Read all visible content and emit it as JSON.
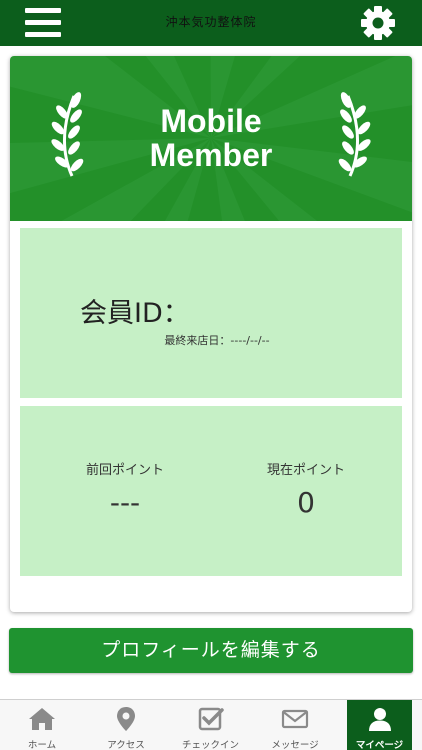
{
  "header": {
    "title": "沖本気功整体院"
  },
  "card": {
    "header_title_line1": "Mobile",
    "header_title_line2": "Member",
    "member_id_label": "会員ID：",
    "last_visit_label": "最終来店日：----/--/--",
    "previous_points_label": "前回ポイント",
    "previous_points_value": "---",
    "current_points_label": "現在ポイント",
    "current_points_value": "0"
  },
  "edit_profile_button": "プロフィールを編集する",
  "tabbar": {
    "items": [
      {
        "label": "ホーム",
        "icon": "home-icon"
      },
      {
        "label": "アクセス",
        "icon": "map-pin-icon"
      },
      {
        "label": "チェックイン",
        "icon": "checkin-icon"
      },
      {
        "label": "メッセージ",
        "icon": "mail-icon"
      },
      {
        "label": "マイページ",
        "icon": "user-icon"
      }
    ],
    "active_index": 4
  },
  "colors": {
    "topbar": "#0c5e1c",
    "card_header": "#2a9632",
    "panel": "#c6f0c6",
    "button": "#1f9330",
    "active_tab": "#0c5e1c"
  }
}
